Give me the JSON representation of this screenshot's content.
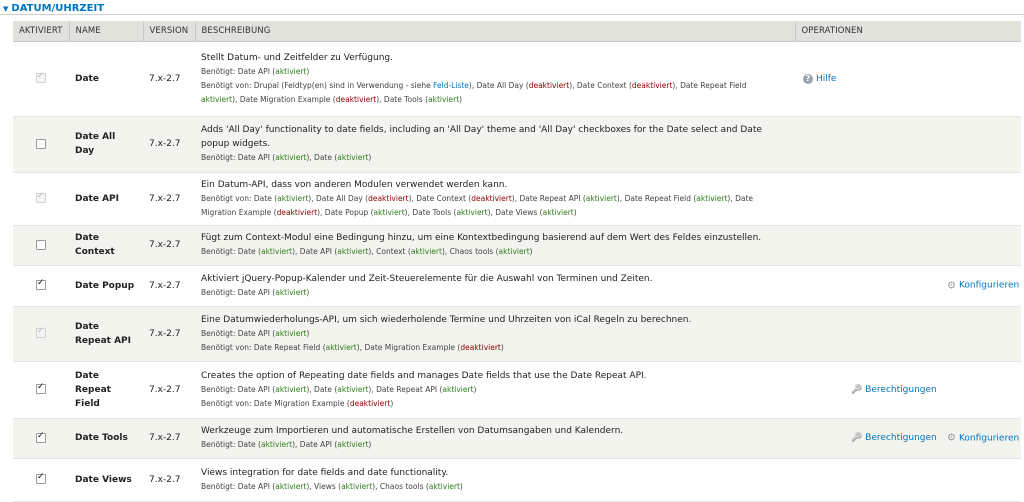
{
  "section": {
    "title": "DATUM/UHRZEIT"
  },
  "columns": {
    "enabled": "AKTIVIERT",
    "name": "NAME",
    "version": "VERSION",
    "description": "BESCHREIBUNG",
    "operations": "OPERATIONEN"
  },
  "modules": [
    {
      "name": "Date",
      "version": "7.x-2.7",
      "checked": true,
      "disabled": true,
      "description": "Stellt Datum- und Zeitfelder zu Verfügung.",
      "req_lines": [
        [
          {
            "t": "Benötigt: Date API ("
          },
          {
            "t": "aktiviert",
            "c": "ok"
          },
          {
            "t": ")"
          }
        ],
        [
          {
            "t": "Benötigt von: Drupal (Feldtyp(en) sind in Verwendung - siehe "
          },
          {
            "t": "Feld-Liste",
            "c": "lnk"
          },
          {
            "t": "), Date All Day ("
          },
          {
            "t": "deaktiviert",
            "c": "off"
          },
          {
            "t": "), Date Context ("
          },
          {
            "t": "deaktiviert",
            "c": "off"
          },
          {
            "t": "), Date Repeat Field"
          }
        ],
        [
          {
            "t": "aktiviert",
            "c": "ok"
          },
          {
            "t": "), Date Migration Example ("
          },
          {
            "t": "deaktiviert",
            "c": "off"
          },
          {
            "t": "), Date Tools ("
          },
          {
            "t": "aktiviert",
            "c": "ok"
          },
          {
            "t": ")"
          }
        ]
      ],
      "ops": [
        {
          "label": "Hilfe",
          "icon": "help-icon"
        }
      ]
    },
    {
      "name": "Date All Day",
      "version": "7.x-2.7",
      "checked": false,
      "disabled": false,
      "description": "Adds 'All Day' functionality to date fields, including an 'All Day' theme and 'All Day' checkboxes for the Date select and Date popup widgets.",
      "req_lines": [
        [
          {
            "t": "Benötigt: Date API ("
          },
          {
            "t": "aktiviert",
            "c": "ok"
          },
          {
            "t": "), Date ("
          },
          {
            "t": "aktiviert",
            "c": "ok"
          },
          {
            "t": ")"
          }
        ]
      ],
      "ops": []
    },
    {
      "name": "Date API",
      "version": "7.x-2.7",
      "checked": true,
      "disabled": true,
      "description": "Ein Datum-API, dass von anderen Modulen verwendet werden kann.",
      "req_lines": [
        [
          {
            "t": "Benötigt von: Date ("
          },
          {
            "t": "aktiviert",
            "c": "ok"
          },
          {
            "t": "), Date All Day ("
          },
          {
            "t": "deaktiviert",
            "c": "off"
          },
          {
            "t": "), Date Context ("
          },
          {
            "t": "deaktiviert",
            "c": "off"
          },
          {
            "t": "), Date Repeat API ("
          },
          {
            "t": "aktiviert",
            "c": "ok"
          },
          {
            "t": "), Date Repeat Field ("
          },
          {
            "t": "aktiviert",
            "c": "ok"
          },
          {
            "t": "), Date"
          }
        ],
        [
          {
            "t": "Migration Example ("
          },
          {
            "t": "deaktiviert",
            "c": "off"
          },
          {
            "t": "), Date Popup ("
          },
          {
            "t": "aktiviert",
            "c": "ok"
          },
          {
            "t": "), Date Tools ("
          },
          {
            "t": "aktiviert",
            "c": "ok"
          },
          {
            "t": "), Date Views ("
          },
          {
            "t": "aktiviert",
            "c": "ok"
          },
          {
            "t": ")"
          }
        ]
      ],
      "ops": []
    },
    {
      "name": "Date Context",
      "version": "7.x-2.7",
      "checked": false,
      "disabled": false,
      "description": "Fügt zum Context-Modul eine Bedingung hinzu, um eine Kontextbedingung basierend auf dem Wert des Feldes einzustellen.",
      "req_lines": [
        [
          {
            "t": "Benötigt: Date ("
          },
          {
            "t": "aktiviert",
            "c": "ok"
          },
          {
            "t": "), Date API ("
          },
          {
            "t": "aktiviert",
            "c": "ok"
          },
          {
            "t": "), Context ("
          },
          {
            "t": "aktiviert",
            "c": "ok"
          },
          {
            "t": "), Chaos tools ("
          },
          {
            "t": "aktiviert",
            "c": "ok"
          },
          {
            "t": ")"
          }
        ]
      ],
      "ops": []
    },
    {
      "name": "Date Popup",
      "version": "7.x-2.7",
      "checked": true,
      "disabled": false,
      "description": "Aktiviert jQuery-Popup-Kalender und Zeit-Steuerelemente für die Auswahl von Terminen und Zeiten.",
      "req_lines": [
        [
          {
            "t": "Benötigt: Date API ("
          },
          {
            "t": "aktiviert",
            "c": "ok"
          },
          {
            "t": ")"
          }
        ]
      ],
      "ops": [
        {
          "label": "Konfigurieren",
          "icon": "gear-icon"
        }
      ]
    },
    {
      "name": "Date Repeat API",
      "version": "7.x-2.7",
      "checked": true,
      "disabled": true,
      "description": "Eine Datumwiederholungs-API, um sich wiederholende Termine und Uhrzeiten von iCal Regeln zu berechnen.",
      "req_lines": [
        [
          {
            "t": "Benötigt: Date API ("
          },
          {
            "t": "aktiviert",
            "c": "ok"
          },
          {
            "t": ")"
          }
        ],
        [
          {
            "t": "Benötigt von: Date Repeat Field ("
          },
          {
            "t": "aktiviert",
            "c": "ok"
          },
          {
            "t": "), Date Migration Example ("
          },
          {
            "t": "deaktiviert",
            "c": "off"
          },
          {
            "t": ")"
          }
        ]
      ],
      "ops": []
    },
    {
      "name": "Date Repeat Field",
      "version": "7.x-2.7",
      "checked": true,
      "disabled": false,
      "description": "Creates the option of Repeating date fields and manages Date fields that use the Date Repeat API.",
      "req_lines": [
        [
          {
            "t": "Benötigt: Date API ("
          },
          {
            "t": "aktiviert",
            "c": "ok"
          },
          {
            "t": "), Date ("
          },
          {
            "t": "aktiviert",
            "c": "ok"
          },
          {
            "t": "), Date Repeat API ("
          },
          {
            "t": "aktiviert",
            "c": "ok"
          },
          {
            "t": ")"
          }
        ],
        [
          {
            "t": "Benötigt von: Date Migration Example ("
          },
          {
            "t": "deaktiviert",
            "c": "off"
          },
          {
            "t": ")"
          }
        ]
      ],
      "ops": [
        {
          "label": "Berechtigungen",
          "icon": "key-icon"
        }
      ]
    },
    {
      "name": "Date Tools",
      "version": "7.x-2.7",
      "checked": true,
      "disabled": false,
      "description": "Werkzeuge zum Importieren und automatische Erstellen von Datumsangaben und Kalendern.",
      "req_lines": [
        [
          {
            "t": "Benötigt: Date ("
          },
          {
            "t": "aktiviert",
            "c": "ok"
          },
          {
            "t": "), Date API ("
          },
          {
            "t": "aktiviert",
            "c": "ok"
          },
          {
            "t": ")"
          }
        ]
      ],
      "ops": [
        {
          "label": "Berechtigungen",
          "icon": "key-icon"
        },
        {
          "label": "Konfigurieren",
          "icon": "gear-icon"
        }
      ]
    },
    {
      "name": "Date Views",
      "version": "7.x-2.7",
      "checked": true,
      "disabled": false,
      "description": "Views integration for date fields and date functionality.",
      "req_lines": [
        [
          {
            "t": "Benötigt: Date API ("
          },
          {
            "t": "aktiviert",
            "c": "ok"
          },
          {
            "t": "), Views ("
          },
          {
            "t": "aktiviert",
            "c": "ok"
          },
          {
            "t": "), Chaos tools ("
          },
          {
            "t": "aktiviert",
            "c": "ok"
          },
          {
            "t": ")"
          }
        ]
      ],
      "ops": []
    }
  ]
}
